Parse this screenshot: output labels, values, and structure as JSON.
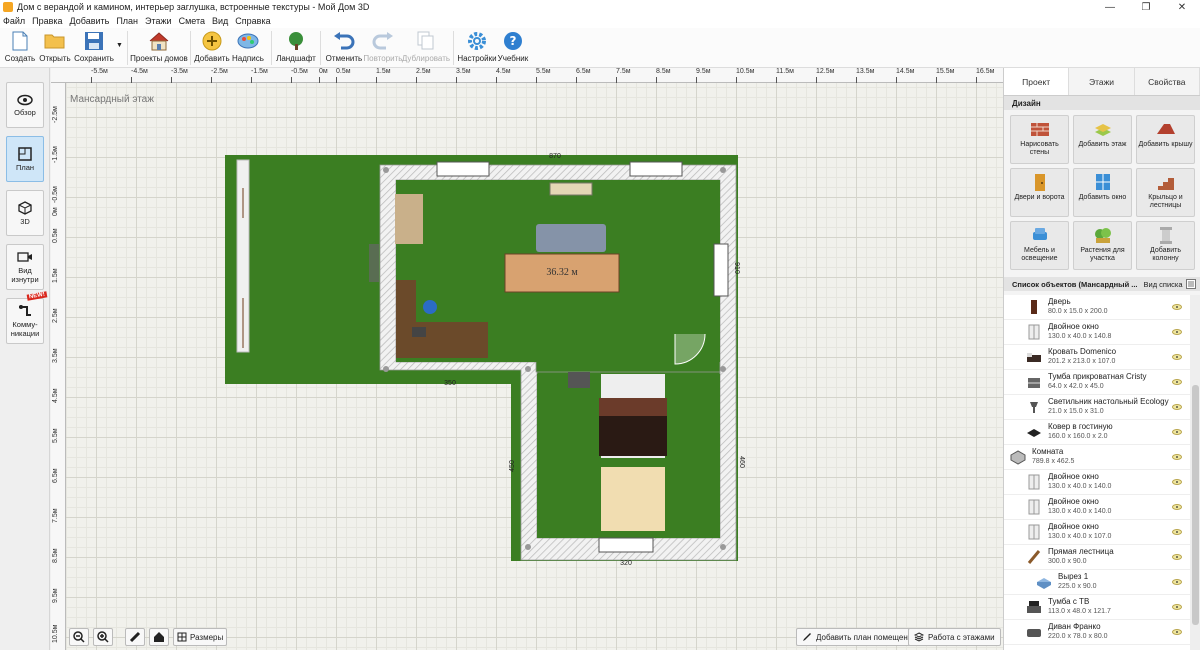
{
  "window": {
    "title": "Дом с верандой и камином, интерьер заглушка, встроенные текстуры - Мой Дом 3D",
    "min": "—",
    "max": "❐",
    "close": "✕"
  },
  "menu": [
    "Файл",
    "Правка",
    "Добавить",
    "План",
    "Этажи",
    "Смета",
    "Вид",
    "Справка"
  ],
  "toolbar": {
    "create": "Создать",
    "open": "Открыть",
    "save": "Сохранить",
    "projects": "Проекты домов",
    "add": "Добавить",
    "label": "Надпись",
    "landscape": "Ландшафт",
    "undo": "Отменить",
    "redo": "Повторить",
    "duplicate": "Дублировать",
    "settings": "Настройки",
    "tutorial": "Учебник"
  },
  "leftbar": {
    "overview": "Обзор",
    "plan": "План",
    "view3d": "3D",
    "inside": "Вид изнутри",
    "comm": "Комму-никации",
    "new_badge": "NEW!"
  },
  "canvas": {
    "floor_label": "Мансардный этаж",
    "room_area": "36.32 м",
    "dims": {
      "top": "870",
      "left_bottom": "350",
      "right": "910",
      "bottom": "320",
      "low_left": "450",
      "low_right": "460"
    },
    "ruler_x": [
      "-5.5м",
      "-4.5м",
      "-3.5м",
      "-2.5м",
      "-1.5м",
      "-0.5м",
      "0м",
      "0.5м",
      "1.5м",
      "2.5м",
      "3.5м",
      "4.5м",
      "5.5м",
      "6.5м",
      "7.5м",
      "8.5м",
      "9.5м",
      "10.5м",
      "11.5м",
      "12.5м",
      "13.5м",
      "14.5м",
      "15.5м",
      "16.5м"
    ],
    "ruler_y": [
      "-2.5м",
      "-1.5м",
      "-0.5м",
      "0м",
      "0.5м",
      "1.5м",
      "2.5м",
      "3.5м",
      "4.5м",
      "5.5м",
      "6.5м",
      "7.5м",
      "8.5м",
      "9.5м",
      "10.5м"
    ],
    "bottom_tools": {
      "sizes": "Размеры",
      "add_room_plan": "Добавить план помещения",
      "floors": "Работа с этажами"
    }
  },
  "rightpanel": {
    "tabs": [
      "Проект",
      "Этажи",
      "Свойства"
    ],
    "design_title": "Дизайн",
    "design_buttons": [
      "Нарисовать стены",
      "Добавить этаж",
      "Добавить крышу",
      "Двери и ворота",
      "Добавить окно",
      "Крыльцо и лестницы",
      "Мебель и освещение",
      "Растения для участка",
      "Добавить колонну"
    ],
    "objects_title": "Список объектов (Мансардный ...",
    "view_list": "Вид списка",
    "objects": [
      {
        "name": "Дверь",
        "dims": "80.0 x 15.0 x 200.0",
        "icon": "door-icon",
        "level": "child"
      },
      {
        "name": "Двойное окно",
        "dims": "130.0 x 40.0 x 140.8",
        "icon": "window-icon",
        "level": "child"
      },
      {
        "name": "Кровать Domenico",
        "dims": "201.2 x 213.0 x 107.0",
        "icon": "bed-icon",
        "level": "child"
      },
      {
        "name": "Тумба прикроватная Cristy",
        "dims": "64.0 x 42.0 x 45.0",
        "icon": "nightstand-icon",
        "level": "child"
      },
      {
        "name": "Светильник настольный Ecology",
        "dims": "21.0 x 15.0 x 31.0",
        "icon": "lamp-icon",
        "level": "child"
      },
      {
        "name": "Ковер в гостиную",
        "dims": "160.0 x 160.0 x 2.0",
        "icon": "rug-icon",
        "level": "child"
      },
      {
        "name": "Комната",
        "dims": "789.8 x 462.5",
        "icon": "room-icon",
        "level": "top"
      },
      {
        "name": "Двойное окно",
        "dims": "130.0 x 40.0 x 140.0",
        "icon": "window-icon",
        "level": "child"
      },
      {
        "name": "Двойное окно",
        "dims": "130.0 x 40.0 x 140.0",
        "icon": "window-icon",
        "level": "child"
      },
      {
        "name": "Двойное окно",
        "dims": "130.0 x 40.0 x 107.0",
        "icon": "window-icon",
        "level": "child"
      },
      {
        "name": "Прямая лестница",
        "dims": "300.0 x 90.0",
        "icon": "stairs-icon",
        "level": "child"
      },
      {
        "name": "Вырез 1",
        "dims": "225.0 x 90.0",
        "icon": "cutout-icon",
        "level": "sub"
      },
      {
        "name": "Тумба с ТВ",
        "dims": "113.0 x 48.0 x 121.7",
        "icon": "tv-stand-icon",
        "level": "child"
      },
      {
        "name": "Диван Франко",
        "dims": "220.0 x 78.0 x 80.0",
        "icon": "sofa-icon",
        "level": "child"
      }
    ]
  }
}
